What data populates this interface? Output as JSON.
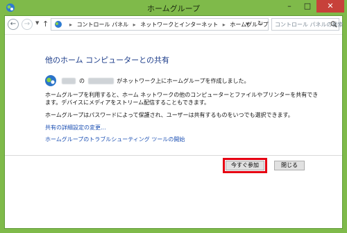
{
  "window": {
    "title": "ホームグループ"
  },
  "controls": {
    "minimize": "–",
    "maximize": "□",
    "close": "✕"
  },
  "nav": {
    "breadcrumbs": [
      "コントロール パネル",
      "ネットワークとインターネット",
      "ホームグループ"
    ],
    "search_placeholder": "コントロール パネルの検索"
  },
  "content": {
    "heading": "他のホーム コンピューターとの共有",
    "created_pre": "の",
    "created_post": "がネットワーク上にホームグループを作成しました。",
    "blurred_user": "Taro",
    "blurred_pc": "xxxxxxx",
    "paragraph1": "ホームグループを利用すると、ホーム ネットワークの他のコンピューターとファイルやプリンターを共有できます。デバイスにメディアをストリーム配信することもできます。",
    "paragraph2": "ホームグループはパスワードによって保護され、ユーザーは共有するものをいつでも選択できます。",
    "link1": "共有の詳細設定の変更...",
    "link2": "ホームグループのトラブルシューティング ツールの開始"
  },
  "buttons": {
    "join": "今すぐ参加",
    "close": "閉じる"
  },
  "colors": {
    "titlebar": "#7fba4a",
    "close_button": "#c7413a",
    "highlight": "#e60012",
    "link": "#1b4fb3"
  }
}
